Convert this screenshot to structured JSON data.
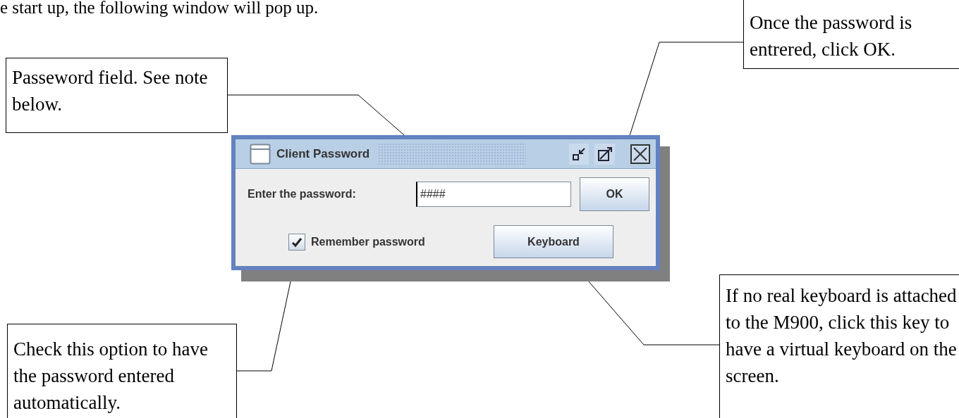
{
  "intro": "e start up, the following window will pop up.",
  "callouts": [
    {
      "text": "Passeword field. See note below."
    },
    {
      "text": "Once the password is entrered, click OK."
    },
    {
      "text": "Check this option to have the password entered automatically."
    },
    {
      "text": "If no real keyboard is attached to the M900, click this key to have a virtual keyboard on the screen."
    }
  ],
  "dialog": {
    "title": "Client Password",
    "password_label": "Enter the password:",
    "password_value": "####",
    "ok_button": "OK",
    "remember": {
      "label": "Remember password",
      "checked": true
    },
    "keyboard_button": "Keyboard"
  }
}
